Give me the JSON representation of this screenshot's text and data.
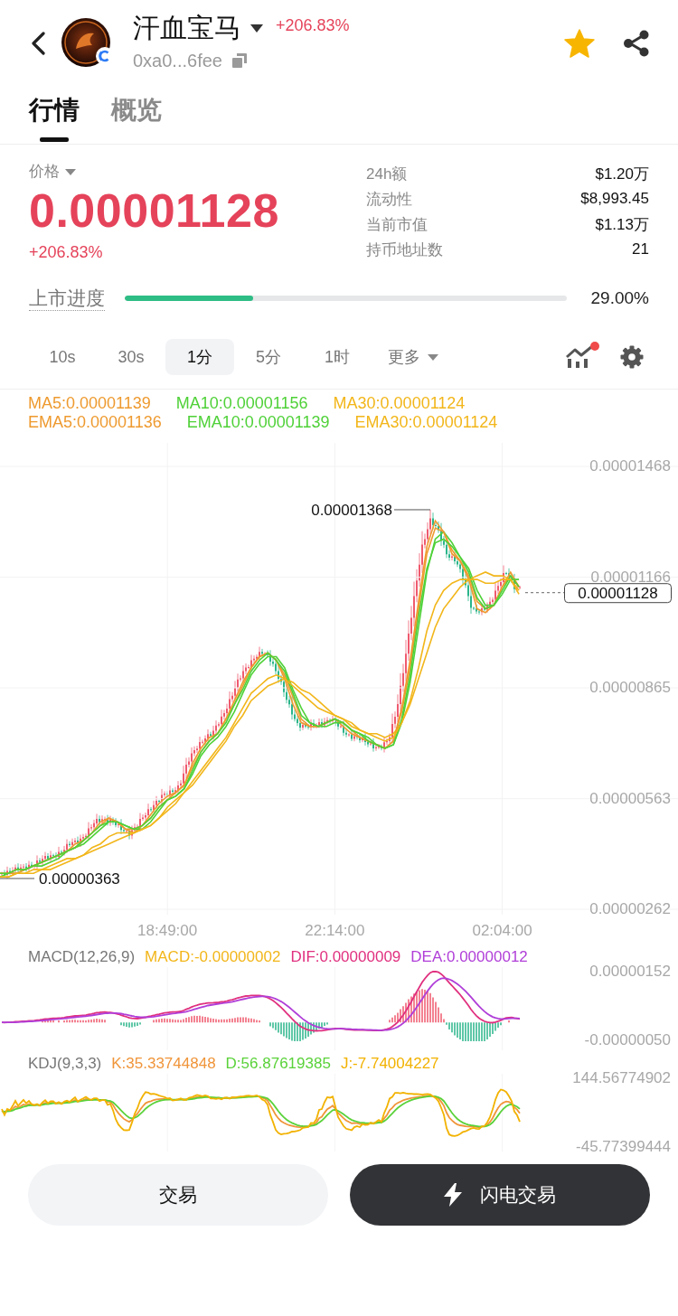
{
  "header": {
    "title": "汗血宝马",
    "change": "+206.83%",
    "address": "0xa0...6fee",
    "favorited": true
  },
  "tabs": [
    {
      "label": "行情",
      "selected": true
    },
    {
      "label": "概览",
      "selected": false
    }
  ],
  "price": {
    "label": "价格",
    "value": "0.00001128",
    "change": "+206.83%"
  },
  "stats": [
    {
      "label": "24h额",
      "value": "$1.20万"
    },
    {
      "label": "流动性",
      "value": "$8,993.45"
    },
    {
      "label": "当前市值",
      "value": "$1.13万"
    },
    {
      "label": "持币地址数",
      "value": "21"
    }
  ],
  "listing_progress": {
    "label": "上市进度",
    "level": 0.29,
    "reading": "29.00%"
  },
  "intervals": [
    {
      "label": "10s",
      "kind": "option",
      "selected": false
    },
    {
      "label": "30s",
      "kind": "option",
      "selected": false
    },
    {
      "label": "1分",
      "kind": "option",
      "selected": true
    },
    {
      "label": "5分",
      "kind": "option",
      "selected": false
    },
    {
      "label": "1时",
      "kind": "option",
      "selected": false
    },
    {
      "label": "更多",
      "kind": "menu",
      "selected": false
    }
  ],
  "toolbar": {
    "indicator_badge": true
  },
  "chart": {
    "chart_data": {
      "type": "line",
      "grid": true,
      "categories": [
        null,
        null,
        null,
        null,
        null,
        null,
        null,
        null,
        null,
        null,
        null,
        null,
        null,
        null,
        null,
        null,
        null,
        null,
        null,
        null,
        "18:49:00",
        null,
        null,
        null,
        null,
        null,
        null,
        null,
        null,
        null,
        null,
        null,
        null,
        null,
        null,
        null,
        null,
        null,
        null,
        null,
        "22:14:00",
        null,
        null,
        null,
        null,
        null,
        null,
        null,
        null,
        null,
        null,
        null,
        null,
        null,
        null,
        null,
        null,
        null,
        null,
        null,
        "02:04:00",
        null,
        null
      ],
      "ylim": [
        2.62e-06,
        1.468e-05
      ],
      "yticks": [
        {
          "value": 1.468e-05,
          "label": "0.00001468"
        },
        {
          "value": 1.166e-05,
          "label": "0.00001166"
        },
        {
          "value": 8.65e-06,
          "label": "0.00000865"
        },
        {
          "value": 5.63e-06,
          "label": "0.00000563"
        },
        {
          "value": 2.62e-06,
          "label": "0.00000262"
        }
      ],
      "series": [
        {
          "name": "MA5:0.00001139",
          "color": "#ee9a2f",
          "values": [
            3.6e-06,
            3.6e-06,
            3.7e-06,
            3.7e-06,
            3.8e-06,
            3.9e-06,
            4e-06,
            4.1e-06,
            4.2e-06,
            4.4e-06,
            4.5e-06,
            4.7e-06,
            5e-06,
            5.1e-06,
            5e-06,
            4.8e-06,
            4.7e-06,
            4.9e-06,
            5.2e-06,
            5.5e-06,
            5.7e-06,
            5.8e-06,
            6e-06,
            6.6e-06,
            7e-06,
            7.3e-06,
            7.4e-06,
            7.8e-06,
            8.3e-06,
            8.8e-06,
            9.2e-06,
            9.5e-06,
            9.6e-06,
            9.4e-06,
            8.9e-06,
            8.2e-06,
            7.7e-06,
            7.6e-06,
            7.6e-06,
            7.7e-06,
            7.8e-06,
            7.6e-06,
            7.4e-06,
            7.3e-06,
            7.2e-06,
            7.1e-06,
            7e-06,
            7.2e-06,
            8.1e-06,
            9.4e-06,
            1.1e-05,
            1.25e-05,
            1.32e-05,
            1.29e-05,
            1.23e-05,
            1.21e-05,
            1.16e-05,
            1.08e-05,
            1.07e-05,
            1.09e-05,
            1.14e-05,
            1.18e-05,
            1.14e-05
          ]
        },
        {
          "name": "MA10:0.00001156",
          "color": "#4fd138",
          "values": [
            3.5e-06,
            3.6e-06,
            3.6e-06,
            3.7e-06,
            3.8e-06,
            3.8e-06,
            3.9e-06,
            4e-06,
            4.2e-06,
            4.3e-06,
            4.4e-06,
            4.6e-06,
            4.8e-06,
            5e-06,
            5e-06,
            4.9e-06,
            4.8e-06,
            4.8e-06,
            5e-06,
            5.3e-06,
            5.6e-06,
            5.7e-06,
            5.9e-06,
            6.3e-06,
            6.8e-06,
            7.1e-06,
            7.3e-06,
            7.6e-06,
            8e-06,
            8.5e-06,
            9e-06,
            9.3e-06,
            9.5e-06,
            9.5e-06,
            9.2e-06,
            8.6e-06,
            8.1e-06,
            7.7e-06,
            7.6e-06,
            7.6e-06,
            7.7e-06,
            7.7e-06,
            7.5e-06,
            7.4e-06,
            7.3e-06,
            7.1e-06,
            7e-06,
            7.1e-06,
            7.7e-06,
            8.8e-06,
            1.03e-05,
            1.18e-05,
            1.27e-05,
            1.29e-05,
            1.26e-05,
            1.22e-05,
            1.19e-05,
            1.13e-05,
            1.09e-05,
            1.09e-05,
            1.12e-05,
            1.16e-05,
            1.16e-05
          ]
        },
        {
          "name": "MA30:0.00001124",
          "color": "#f2b61a",
          "values": [
            3.5e-06,
            3.5e-06,
            3.6e-06,
            3.6e-06,
            3.6e-06,
            3.7e-06,
            3.7e-06,
            3.8e-06,
            3.9e-06,
            4e-06,
            4.1e-06,
            4.2e-06,
            4.3e-06,
            4.4e-06,
            4.5e-06,
            4.6e-06,
            4.7e-06,
            4.8e-06,
            4.9e-06,
            5.1e-06,
            5.3e-06,
            5.5e-06,
            5.8e-06,
            6e-06,
            6.3e-06,
            6.6e-06,
            6.9e-06,
            7.2e-06,
            7.6e-06,
            7.9e-06,
            8.3e-06,
            8.5e-06,
            8.7e-06,
            8.8e-06,
            8.9e-06,
            8.8e-06,
            8.6e-06,
            8.5e-06,
            8.3e-06,
            8.1e-06,
            7.9e-06,
            7.8e-06,
            7.7e-06,
            7.5e-06,
            7.4e-06,
            7.4e-06,
            7.3e-06,
            7.4e-06,
            7.7e-06,
            8.2e-06,
            8.9e-06,
            9.6e-06,
            1.03e-05,
            1.08e-05,
            1.11e-05,
            1.14e-05,
            1.16e-05,
            1.17e-05,
            1.18e-05,
            1.17e-05,
            1.17e-05,
            1.16e-05,
            1.13e-05
          ]
        },
        {
          "name": "EMA5:0.00001136",
          "color": "#ee9a2f",
          "values": [
            3.6e-06,
            3.6e-06,
            3.6e-06,
            3.7e-06,
            3.8e-06,
            3.9e-06,
            4e-06,
            4.1e-06,
            4.2e-06,
            4.3e-06,
            4.5e-06,
            4.7e-06,
            4.9e-06,
            5.1e-06,
            5e-06,
            4.8e-06,
            4.8e-06,
            4.9e-06,
            5.1e-06,
            5.4e-06,
            5.6e-06,
            5.8e-06,
            6e-06,
            6.5e-06,
            6.9e-06,
            7.2e-06,
            7.4e-06,
            7.8e-06,
            8.2e-06,
            8.7e-06,
            9.2e-06,
            9.5e-06,
            9.6e-06,
            9.4e-06,
            9e-06,
            8.4e-06,
            7.8e-06,
            7.6e-06,
            7.6e-06,
            7.7e-06,
            7.8e-06,
            7.7e-06,
            7.5e-06,
            7.3e-06,
            7.2e-06,
            7.1e-06,
            7e-06,
            7.2e-06,
            8e-06,
            9.2e-06,
            1.08e-05,
            1.23e-05,
            1.3e-05,
            1.29e-05,
            1.24e-05,
            1.21e-05,
            1.17e-05,
            1.1e-05,
            1.08e-05,
            1.09e-05,
            1.14e-05,
            1.17e-05,
            1.14e-05
          ]
        },
        {
          "name": "EMA10:0.00001139",
          "color": "#4fd138",
          "values": [
            3.6e-06,
            3.6e-06,
            3.7e-06,
            3.7e-06,
            3.8e-06,
            3.9e-06,
            4e-06,
            4.1e-06,
            4.2e-06,
            4.3e-06,
            4.5e-06,
            4.7e-06,
            4.9e-06,
            5e-06,
            5e-06,
            4.9e-06,
            4.8e-06,
            4.9e-06,
            5.1e-06,
            5.4e-06,
            5.6e-06,
            5.7e-06,
            5.9e-06,
            6.4e-06,
            6.9e-06,
            7.2e-06,
            7.4e-06,
            7.7e-06,
            8.2e-06,
            8.6e-06,
            9.1e-06,
            9.4e-06,
            9.6e-06,
            9.4e-06,
            9.1e-06,
            8.5e-06,
            7.9e-06,
            7.7e-06,
            7.6e-06,
            7.7e-06,
            7.8e-06,
            7.7e-06,
            7.5e-06,
            7.4e-06,
            7.2e-06,
            7.1e-06,
            7e-06,
            7.1e-06,
            7.8e-06,
            9e-06,
            1.06e-05,
            1.19e-05,
            1.26e-05,
            1.27e-05,
            1.25e-05,
            1.22e-05,
            1.18e-05,
            1.11e-05,
            1.08e-05,
            1.09e-05,
            1.13e-05,
            1.17e-05,
            1.14e-05
          ]
        },
        {
          "name": "EMA30:0.00001124",
          "color": "#f2b61a",
          "values": [
            3.5e-06,
            3.5e-06,
            3.6e-06,
            3.6e-06,
            3.7e-06,
            3.7e-06,
            3.8e-06,
            3.9e-06,
            4e-06,
            4e-06,
            4.1e-06,
            4.3e-06,
            4.4e-06,
            4.6e-06,
            4.7e-06,
            4.7e-06,
            4.7e-06,
            4.8e-06,
            4.9e-06,
            5.1e-06,
            5.4e-06,
            5.6e-06,
            5.8e-06,
            6.1e-06,
            6.4e-06,
            6.7e-06,
            7e-06,
            7.3e-06,
            7.7e-06,
            8.1e-06,
            8.5e-06,
            8.7e-06,
            8.9e-06,
            9e-06,
            8.9e-06,
            8.7e-06,
            8.5e-06,
            8.3e-06,
            8.1e-06,
            8e-06,
            7.9e-06,
            7.8e-06,
            7.6e-06,
            7.5e-06,
            7.4e-06,
            7.3e-06,
            7.2e-06,
            7.3e-06,
            7.7e-06,
            8.3e-06,
            9.2e-06,
            1.02e-05,
            1.09e-05,
            1.13e-05,
            1.15e-05,
            1.16e-05,
            1.16e-05,
            1.16e-05,
            1.15e-05,
            1.15e-05,
            1.16e-05,
            1.16e-05,
            1.12e-05
          ]
        }
      ]
    },
    "high_label": "0.00001368",
    "low_label": "0.00000363",
    "last_price": "0.00001128"
  },
  "macd": {
    "title": "MACD(12,26,9)",
    "values": [
      {
        "text": "MACD:-0.00000002",
        "color": "#f2b61a"
      },
      {
        "text": "DIF:0.00000009",
        "color": "#e0307f"
      },
      {
        "text": "DEA:0.00000012",
        "color": "#b03ed8"
      }
    ],
    "axis_labels": [
      "0.00000152",
      "-0.00000050"
    ]
  },
  "kdj": {
    "title": "KDJ(9,3,3)",
    "values": [
      {
        "text": "K:35.33744848",
        "color": "#f0953a"
      },
      {
        "text": "D:56.87619385",
        "color": "#5ad23a"
      },
      {
        "text": "J:-7.74004227",
        "color": "#f2b200"
      }
    ],
    "axis_labels": [
      "144.56774902",
      "-45.77399444"
    ]
  },
  "buttons": [
    {
      "label": "交易",
      "kind": "secondary"
    },
    {
      "label": "闪电交易",
      "kind": "primary"
    }
  ]
}
